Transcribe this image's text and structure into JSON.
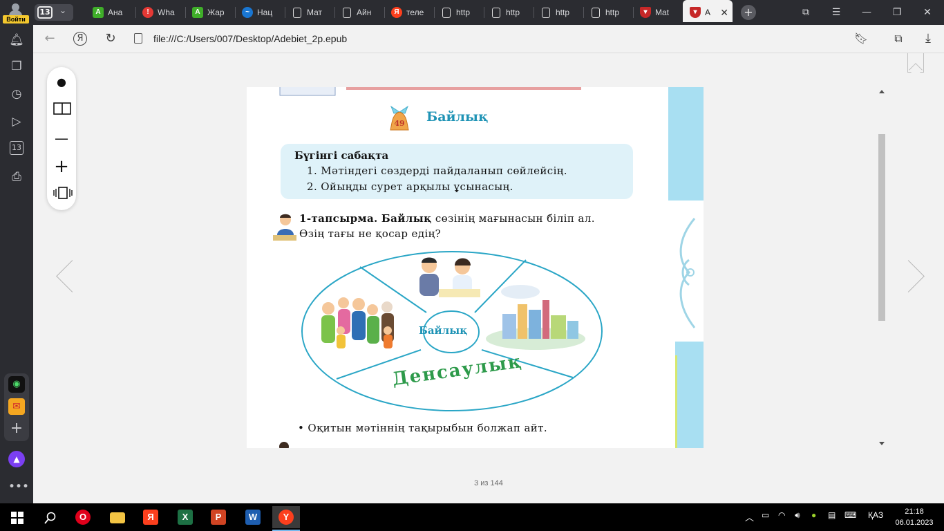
{
  "browser": {
    "profile_label": "Войти",
    "tab_count": "13",
    "tabs": [
      {
        "label": "Ана",
        "icon": "green-a-icon",
        "color": "#3fae29"
      },
      {
        "label": "Wha",
        "icon": "red-alert-icon",
        "color": "#e53935"
      },
      {
        "label": "Жар",
        "icon": "green-a-icon",
        "color": "#3fae29"
      },
      {
        "label": "Нац",
        "icon": "swirl-icon",
        "color": "#1976d2"
      },
      {
        "label": "Мат",
        "icon": "document-icon",
        "color": "#dddddd"
      },
      {
        "label": "Айн",
        "icon": "document-icon",
        "color": "#dddddd"
      },
      {
        "label": "теле",
        "icon": "yandex-icon",
        "color": "#fc3f1d"
      },
      {
        "label": "http",
        "icon": "document-icon",
        "color": "#dddddd"
      },
      {
        "label": "http",
        "icon": "document-icon",
        "color": "#dddddd"
      },
      {
        "label": "http",
        "icon": "document-icon",
        "color": "#dddddd"
      },
      {
        "label": "http",
        "icon": "document-icon",
        "color": "#dddddd"
      },
      {
        "label": "Mat",
        "icon": "shield-icon",
        "color": "#c62828"
      },
      {
        "label": "А",
        "icon": "shield-icon",
        "color": "#c62828",
        "active": true
      }
    ],
    "address": "file:///C:/Users/007/Desktop/Adebiet_2p.epub"
  },
  "sidebar": {
    "icons": [
      "bell-icon",
      "collections-icon",
      "history-icon",
      "play-icon",
      "tabs-13-icon",
      "screenshot-icon",
      "alice-app-icon",
      "mail-icon",
      "add-icon",
      "alice-icon",
      "more-icon"
    ]
  },
  "viewer": {
    "page_counter": "3 из 144",
    "lesson": {
      "number": "49",
      "title": "Байлық",
      "goals_heading": "Бүгінгі сабақта",
      "goals": [
        "1. Мәтіндегі сөздерді пайдаланып сөйлейсің.",
        "2. Ойыңды сурет арқылы ұсынасың."
      ],
      "task_label": "1-тапсырма.",
      "task_word": "Байлық",
      "task_rest": "сөзінің мағынасын біліп ал.",
      "task_line2": "Өзің тағы не қосар едің?",
      "diagram_center": "Байлық",
      "diagram_health": "Денсаулық",
      "bullet": "Оқитын мәтіннің тақырыбын болжап айт."
    }
  },
  "taskbar": {
    "apps": [
      {
        "name": "opera",
        "label": "O",
        "color": "#e0001b"
      },
      {
        "name": "explorer",
        "label": "",
        "color": "#f3c443"
      },
      {
        "name": "yandex-browser",
        "label": "Я",
        "color": "#fc3f1d"
      },
      {
        "name": "excel",
        "label": "X",
        "color": "#1d7044"
      },
      {
        "name": "powerpoint",
        "label": "P",
        "color": "#d04423"
      },
      {
        "name": "word",
        "label": "W",
        "color": "#1e5eb0"
      },
      {
        "name": "yandex-browser-active",
        "label": "Y",
        "color": "#fc3f1d"
      }
    ],
    "language": "ҚАЗ",
    "time": "21:18",
    "date": "06.01.2023"
  },
  "colors": {
    "accent_blue": "#1e93b5",
    "health_green": "#2d9a4a",
    "goals_bg": "#dff2f9"
  }
}
